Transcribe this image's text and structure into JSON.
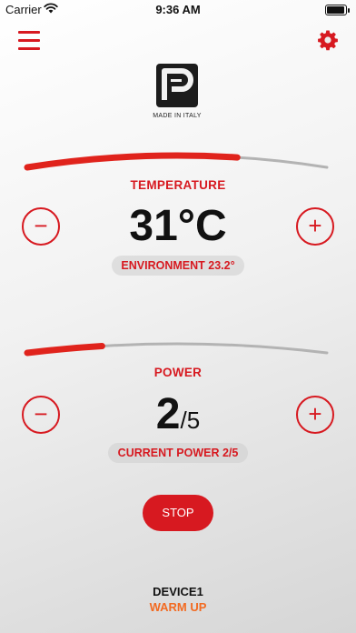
{
  "status_bar": {
    "carrier": "Carrier",
    "time": "9:36 AM",
    "battery_level": 1.0
  },
  "header": {
    "menu_icon": "hamburger-menu-icon",
    "settings_icon": "gear-icon",
    "logo_caption": "MADE IN ITALY"
  },
  "colors": {
    "accent": "#d71920",
    "track": "#b3b3b3",
    "status": "#f26a21"
  },
  "temperature": {
    "label": "TEMPERATURE",
    "value": "31°C",
    "environment": "ENVIRONMENT 23.2°",
    "slider_level": 0.7,
    "decrease_label": "−",
    "increase_label": "+"
  },
  "power": {
    "label": "POWER",
    "value": "2",
    "separator": "/",
    "max": "5",
    "current": "CURRENT POWER 2/5",
    "slider_level": 0.25,
    "decrease_label": "−",
    "increase_label": "+"
  },
  "stop_label": "STOP",
  "device": {
    "name": "DEVICE1",
    "status": "WARM UP"
  }
}
